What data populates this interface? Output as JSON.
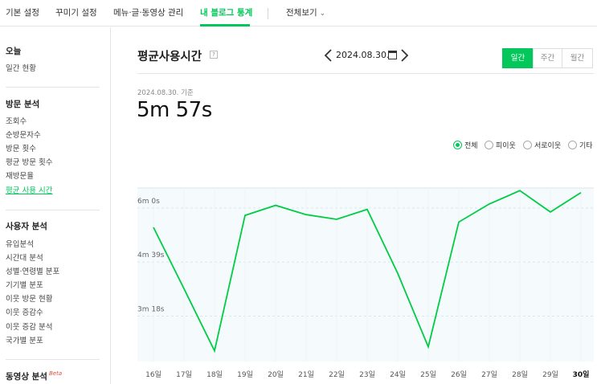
{
  "topnav": {
    "items": [
      "기본 설정",
      "꾸미기 설정",
      "메뉴·글·동영상 관리",
      "내 블로그 통계",
      "전체보기"
    ],
    "active_index": 3
  },
  "sidebar": {
    "today": {
      "title": "오늘",
      "items": [
        "일간 현황"
      ]
    },
    "visit": {
      "title": "방문 분석",
      "items": [
        "조회수",
        "순방문자수",
        "방문 횟수",
        "평균 방문 횟수",
        "재방문율",
        "평균 사용 시간"
      ],
      "active": "평균 사용 시간"
    },
    "user": {
      "title": "사용자 분석",
      "items": [
        "유입분석",
        "시간대 분석",
        "성별·연령별 분포",
        "기기별 분포",
        "이웃 방문 현황",
        "이웃 증감수",
        "이웃 증감 분석",
        "국가별 분포"
      ]
    },
    "video": {
      "title": "동영상 분석",
      "badge": "Beta"
    }
  },
  "main": {
    "title": "평균사용시간",
    "help": "?",
    "date": "2024.08.30.",
    "periods": [
      "일간",
      "주간",
      "월간"
    ],
    "active_period": "일간",
    "basis": "2024.08.30. 기준",
    "value": "5m 57s",
    "filters": [
      "전체",
      "피이웃",
      "서로이웃",
      "기타"
    ],
    "active_filter": "전체"
  },
  "colors": {
    "accent": "#03c75a",
    "line": "#00cc44",
    "grid": "#d9e6f0",
    "plot_bg": "#f5fafd"
  },
  "chart_data": {
    "type": "line",
    "x": [
      "16일",
      "17일",
      "18일",
      "19일",
      "20일",
      "21일",
      "22일",
      "23일",
      "24일",
      "25일",
      "26일",
      "27일",
      "28일",
      "29일",
      "30일"
    ],
    "highlight_x": "30일",
    "series": [
      {
        "values": [
          331,
          239,
          146,
          349,
          364,
          350,
          343,
          358,
          262,
          152,
          339,
          366,
          386,
          354,
          383
        ]
      }
    ],
    "y_ticks": [
      {
        "value": 360,
        "label": "6m 0s"
      },
      {
        "value": 279,
        "label": "4m 39s"
      },
      {
        "value": 198,
        "label": "3m 18s"
      }
    ],
    "unit": "seconds",
    "ylim": [
      130,
      390
    ],
    "grid": true
  }
}
